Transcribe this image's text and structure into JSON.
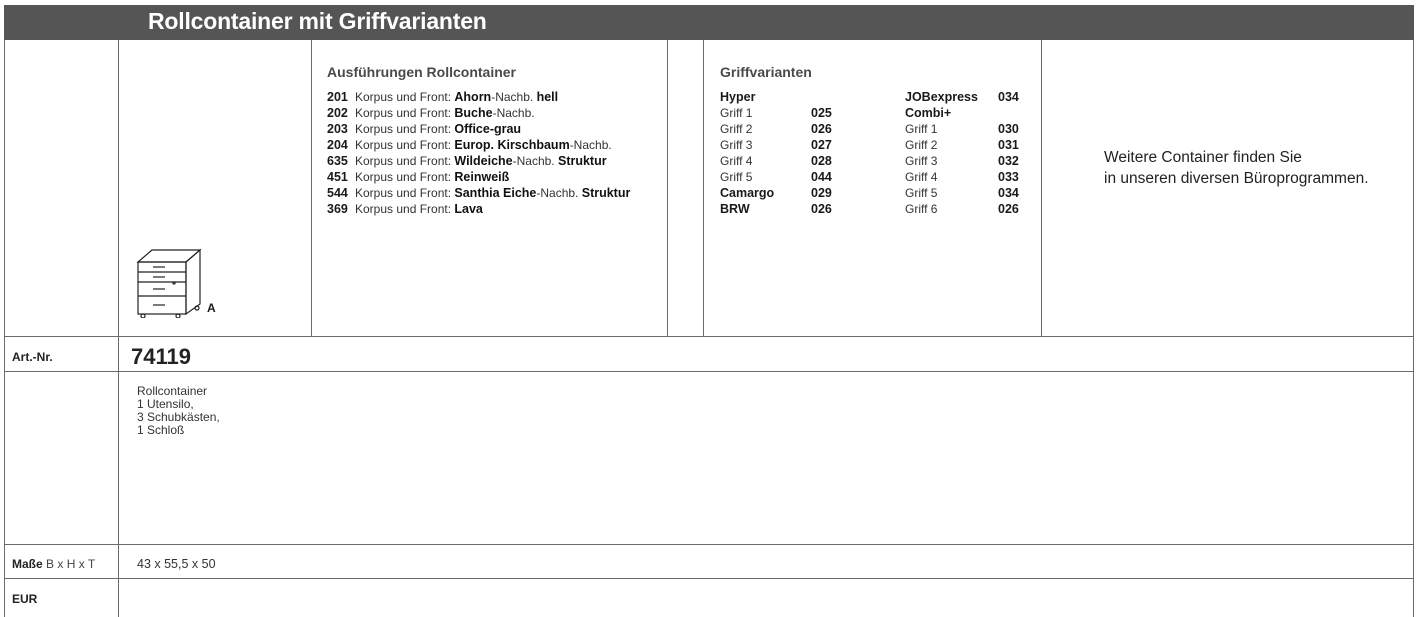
{
  "header": {
    "title": "Rollcontainer mit Griffvarianten"
  },
  "product_image": {
    "icon": "rolling-cabinet-drawing",
    "label": "A"
  },
  "ausfuehrungen": {
    "title": "Ausführungen Rollcontainer",
    "items": [
      {
        "code": "201",
        "prefix": "Korpus und Front: ",
        "bold": "Ahorn",
        "rest": "-Nachb. ",
        "bold2": "hell"
      },
      {
        "code": "202",
        "prefix": "Korpus und Front: ",
        "bold": "Buche",
        "rest": "-Nachb.",
        "bold2": ""
      },
      {
        "code": "203",
        "prefix": "Korpus und Front: ",
        "bold": "Office-grau",
        "rest": "",
        "bold2": ""
      },
      {
        "code": "204",
        "prefix": "Korpus und Front: ",
        "bold": "Europ. Kirschbaum",
        "rest": "-Nachb.",
        "bold2": ""
      },
      {
        "code": "635",
        "prefix": "Korpus und Front: ",
        "bold": "Wildeiche",
        "rest": "-Nachb. ",
        "bold2": "Struktur"
      },
      {
        "code": "451",
        "prefix": "Korpus und Front: ",
        "bold": "Reinweiß",
        "rest": "",
        "bold2": ""
      },
      {
        "code": "544",
        "prefix": "Korpus und Front: ",
        "bold": "Santhia Eiche",
        "rest": "-Nachb. ",
        "bold2": "Struktur"
      },
      {
        "code": "369",
        "prefix": "Korpus und Front: ",
        "bold": "Lava",
        "rest": "",
        "bold2": ""
      }
    ]
  },
  "griffvarianten": {
    "title": "Griffvarianten",
    "left": [
      {
        "label": "Hyper",
        "code": "",
        "heading": true
      },
      {
        "label": "Griff 1",
        "code": "025",
        "heading": false
      },
      {
        "label": "Griff 2",
        "code": "026",
        "heading": false
      },
      {
        "label": "Griff 3",
        "code": "027",
        "heading": false
      },
      {
        "label": "Griff 4",
        "code": "028",
        "heading": false
      },
      {
        "label": "Griff 5",
        "code": "044",
        "heading": false
      },
      {
        "label": "Camargo",
        "code": "029",
        "heading": true
      },
      {
        "label": "BRW",
        "code": "026",
        "heading": true
      }
    ],
    "right": [
      {
        "label": "JOBexpress",
        "code": "034",
        "heading": true
      },
      {
        "label": "Combi+",
        "code": "",
        "heading": true
      },
      {
        "label": "Griff 1",
        "code": "030",
        "heading": false
      },
      {
        "label": "Griff 2",
        "code": "031",
        "heading": false
      },
      {
        "label": "Griff 3",
        "code": "032",
        "heading": false
      },
      {
        "label": "Griff 4",
        "code": "033",
        "heading": false
      },
      {
        "label": "Griff 5",
        "code": "034",
        "heading": false
      },
      {
        "label": "Griff 6",
        "code": "026",
        "heading": false
      }
    ]
  },
  "info": {
    "line1": "Weitere Container finden Sie",
    "line2": "in unseren diversen Büroprogrammen."
  },
  "rows": {
    "artnr_label": "Art.-Nr.",
    "artnr_value": "74119",
    "description": [
      "Rollcontainer",
      "1 Utensilo,",
      "3 Schubkästen,",
      "1 Schloß"
    ],
    "masse_label": "Maße",
    "masse_sub": "B x H x T",
    "masse_value": "43 x 55,5 x 50",
    "eur_label": "EUR"
  },
  "colors": {
    "header_bg": "#555555",
    "header_text": "#ffffff",
    "rule": "#6b6b6b"
  }
}
